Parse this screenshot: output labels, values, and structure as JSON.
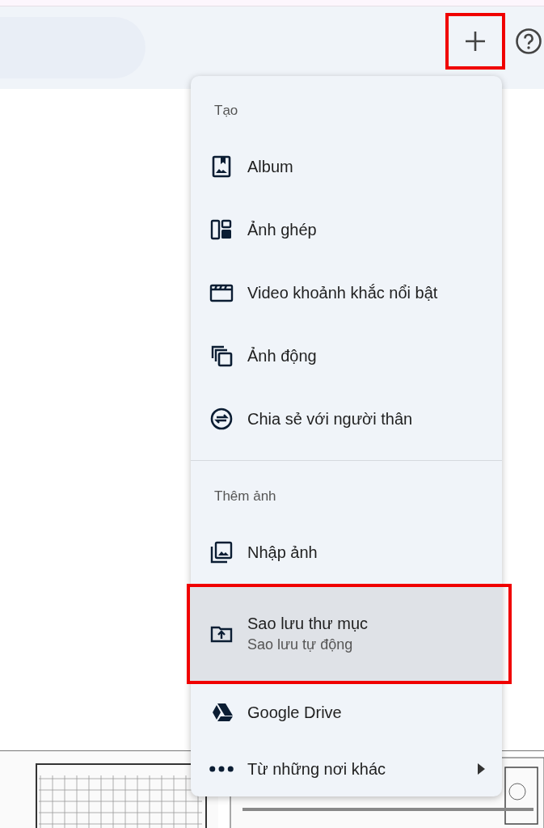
{
  "header": {
    "add_button": {
      "annotated": true
    }
  },
  "menu": {
    "sections": [
      {
        "title": "Tạo",
        "items": [
          {
            "label": "Album",
            "annotated": false,
            "selected": false
          },
          {
            "label": "Ảnh ghép",
            "annotated": false,
            "selected": false
          },
          {
            "label": "Video khoảnh khắc nổi bật",
            "annotated": false,
            "selected": false
          },
          {
            "label": "Ảnh động",
            "annotated": false,
            "selected": false
          },
          {
            "label": "Chia sẻ với người thân",
            "annotated": false,
            "selected": false
          }
        ]
      },
      {
        "title": "Thêm ảnh",
        "items": [
          {
            "label": "Nhập ảnh",
            "annotated": false,
            "selected": false
          },
          {
            "label": "Sao lưu thư mục",
            "sublabel": "Sao lưu tự động",
            "annotated": true,
            "selected": true
          },
          {
            "label": "Google Drive",
            "annotated": false,
            "selected": false
          },
          {
            "label": "Từ những nơi khác",
            "annotated": false,
            "selected": false,
            "has_submenu": true
          }
        ]
      }
    ]
  }
}
